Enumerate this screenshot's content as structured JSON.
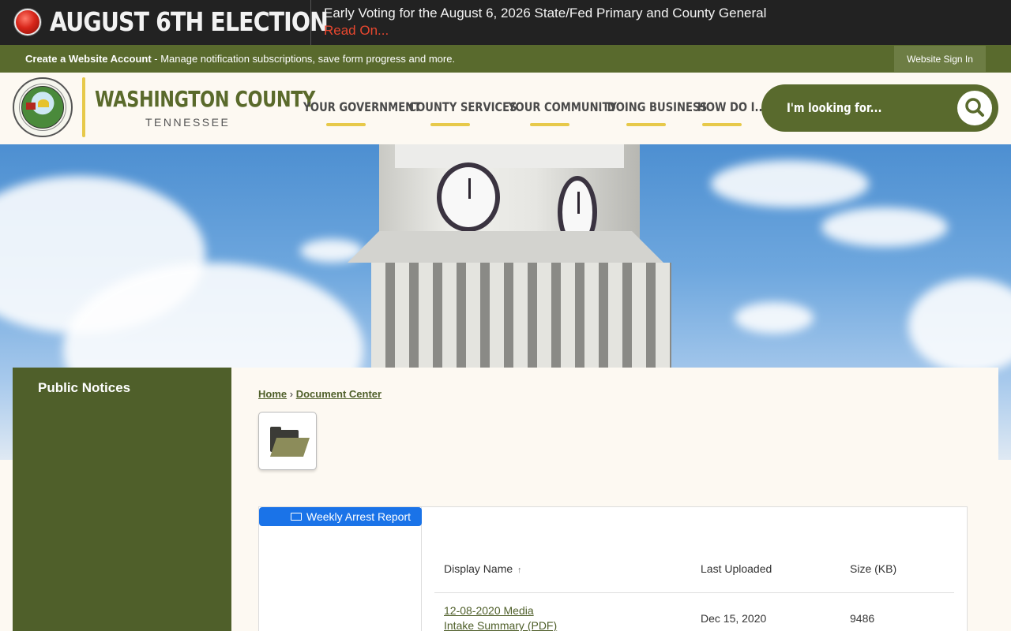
{
  "alert": {
    "title": "AUGUST 6TH ELECTION",
    "message": "Early Voting for the August 6, 2026 State/Fed Primary and County General",
    "read_more": "Read On..."
  },
  "account_bar": {
    "create_link": "Create a Website Account",
    "description": " - Manage notification subscriptions, save form progress and more.",
    "sign_in": "Website Sign In"
  },
  "header": {
    "logo_name": "WASHINGTON COUNTY",
    "logo_state": "TENNESSEE",
    "nav": [
      "YOUR GOVERNMENT",
      "COUNTY SERVICES",
      "YOUR COMMUNITY",
      "DOING BUSINESS",
      "HOW DO I..."
    ],
    "search_placeholder": "I'm looking for..."
  },
  "sidebar": {
    "items": [
      {
        "label": "Public Notices"
      }
    ]
  },
  "breadcrumb": {
    "home": "Home",
    "separator": "›",
    "current": "Document Center"
  },
  "document_center": {
    "tree": [
      {
        "label": "Weekly Arrest Report"
      }
    ],
    "columns": [
      "Display Name",
      "Last Uploaded",
      "Size (KB)"
    ],
    "sort_indicator": "↑",
    "rows": [
      {
        "name": "12-08-2020 Media Intake Summary (PDF)",
        "uploaded": "Dec 15, 2020",
        "size": "9486"
      }
    ]
  },
  "colors": {
    "brand_green": "#596a2d",
    "accent_yellow": "#e7c94a",
    "alert_red": "#e8472f",
    "tree_selected": "#1a73e8"
  }
}
